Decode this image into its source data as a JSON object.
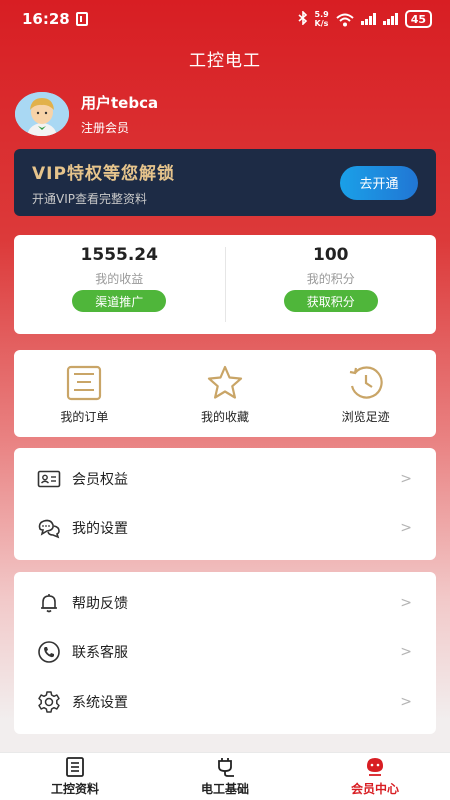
{
  "status_bar": {
    "time": "16:28",
    "network_speed_top": "5.9",
    "network_speed_unit": "K/s",
    "battery": "45"
  },
  "app": {
    "title": "工控电工"
  },
  "profile": {
    "username": "用户tebca",
    "member_type": "注册会员"
  },
  "vip": {
    "title": "VIP特权等您解锁",
    "subtitle": "开通VIP查看完整资料",
    "button": "去开通",
    "colors": {
      "bg": "#1d2b45",
      "title": "#e6c48c",
      "button": "#1aa0e8"
    }
  },
  "stats": [
    {
      "value": "1555.24",
      "label": "我的收益",
      "button": "渠道推广"
    },
    {
      "value": "100",
      "label": "我的积分",
      "button": "获取积分"
    }
  ],
  "quick_links": [
    {
      "label": "我的订单",
      "icon": "order-list-icon"
    },
    {
      "label": "我的收藏",
      "icon": "star-icon"
    },
    {
      "label": "浏览足迹",
      "icon": "history-clock-icon"
    }
  ],
  "menu_group_1": [
    {
      "label": "会员权益",
      "icon": "member-card-icon"
    },
    {
      "label": "我的设置",
      "icon": "chat-bubbles-icon"
    }
  ],
  "menu_group_2": [
    {
      "label": "帮助反馈",
      "icon": "bell-icon"
    },
    {
      "label": "联系客服",
      "icon": "phone-icon"
    },
    {
      "label": "系统设置",
      "icon": "gear-icon"
    }
  ],
  "menu_arrow": ">",
  "bottom_nav": [
    {
      "label": "工控资料",
      "icon": "document-icon",
      "active": false
    },
    {
      "label": "电工基础",
      "icon": "plug-icon",
      "active": false
    },
    {
      "label": "会员中心",
      "icon": "member-face-icon",
      "active": true
    }
  ],
  "accent_color": "#d81e23"
}
